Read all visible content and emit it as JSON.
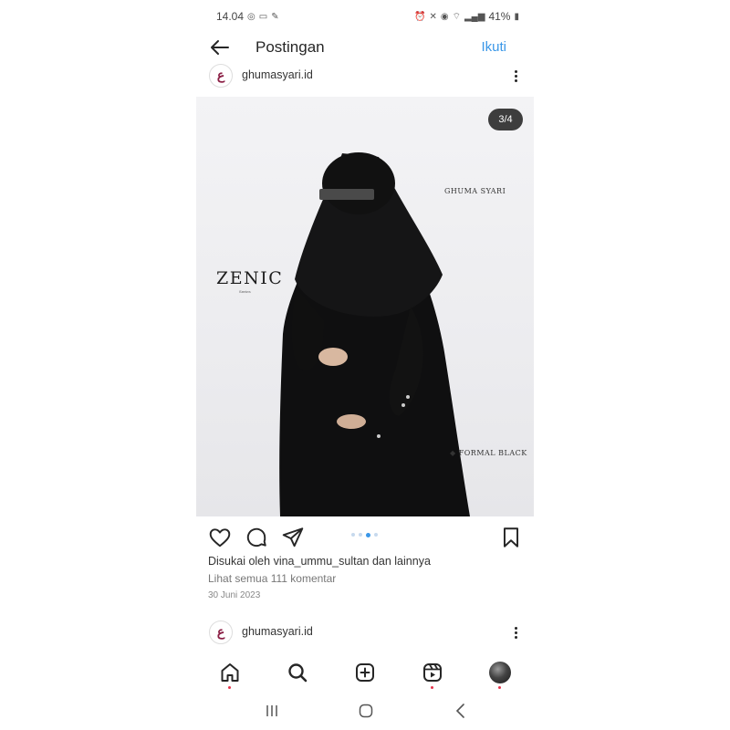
{
  "status_bar": {
    "time": "14.04",
    "battery": "41%"
  },
  "header": {
    "title": "Postingan",
    "follow_label": "Ikuti"
  },
  "post": {
    "username": "ghumasyari.id",
    "avatar_glyph": "ع",
    "counter": "3/4",
    "image_text": {
      "brand": "GHUMA SYARI",
      "collection": "ZENIC",
      "collection_sub": "Series",
      "variant": "◆ FORMAL BLACK"
    },
    "carousel": {
      "total": 4,
      "active_index": 2
    },
    "likes_text": "Disukai oleh vina_ummu_sultan dan lainnya",
    "comments_text": "Lihat semua 111 komentar",
    "date": "30 Juni 2023"
  },
  "next_post": {
    "username": "ghumasyari.id",
    "avatar_glyph": "ع"
  },
  "bottom_nav": {
    "items": [
      "home-icon",
      "search-icon",
      "add-post-icon",
      "reels-icon",
      "profile-icon"
    ]
  },
  "colors": {
    "accent": "#3a97e8",
    "brand": "#8b1f45",
    "notification": "#e5334b"
  }
}
